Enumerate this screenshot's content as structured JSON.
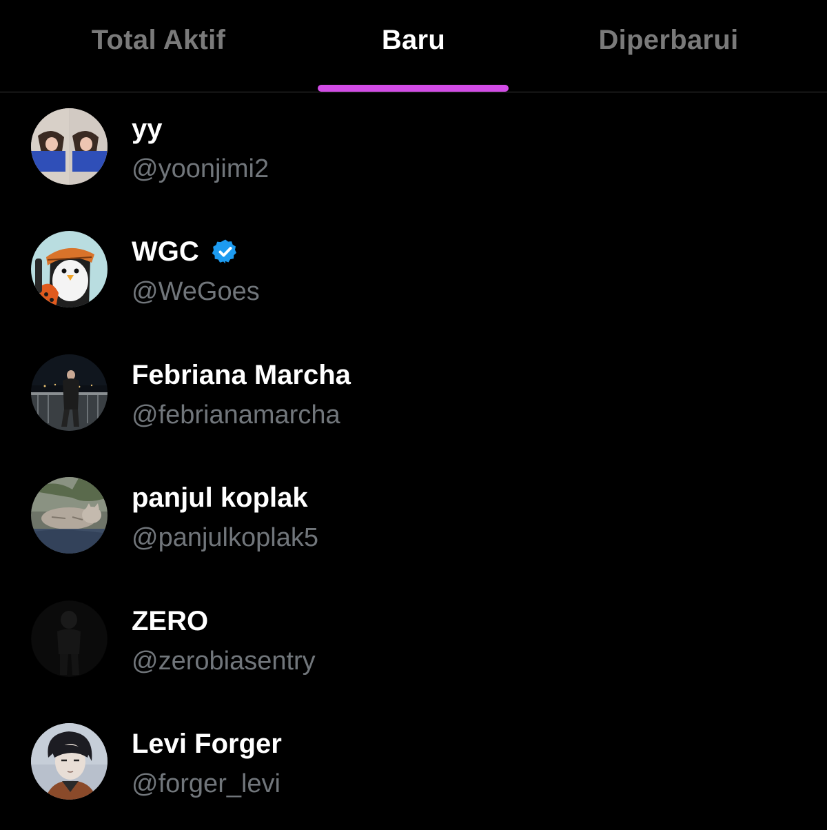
{
  "tabs": [
    {
      "label": "Total Aktif",
      "active": false
    },
    {
      "label": "Baru",
      "active": true
    },
    {
      "label": "Diperbarui",
      "active": false
    }
  ],
  "colors": {
    "accent": "#d24ce6",
    "background": "#000000",
    "primary_text": "#ffffff",
    "secondary_text": "#71767b",
    "verified_badge": "#1d9bf0"
  },
  "users": [
    {
      "name": "yy",
      "handle": "@yoonjimi2",
      "verified": false
    },
    {
      "name": "WGC",
      "handle": "@WeGoes",
      "verified": true,
      "badge_icon": "verified-badge-icon"
    },
    {
      "name": "Febriana Marcha",
      "handle": "@febrianamarcha",
      "verified": false
    },
    {
      "name": "panjul koplak",
      "handle": "@panjulkoplak5",
      "verified": false
    },
    {
      "name": "ZERO",
      "handle": "@zerobiasentry",
      "verified": false
    },
    {
      "name": "Levi Forger",
      "handle": "@forger_levi",
      "verified": false
    }
  ]
}
